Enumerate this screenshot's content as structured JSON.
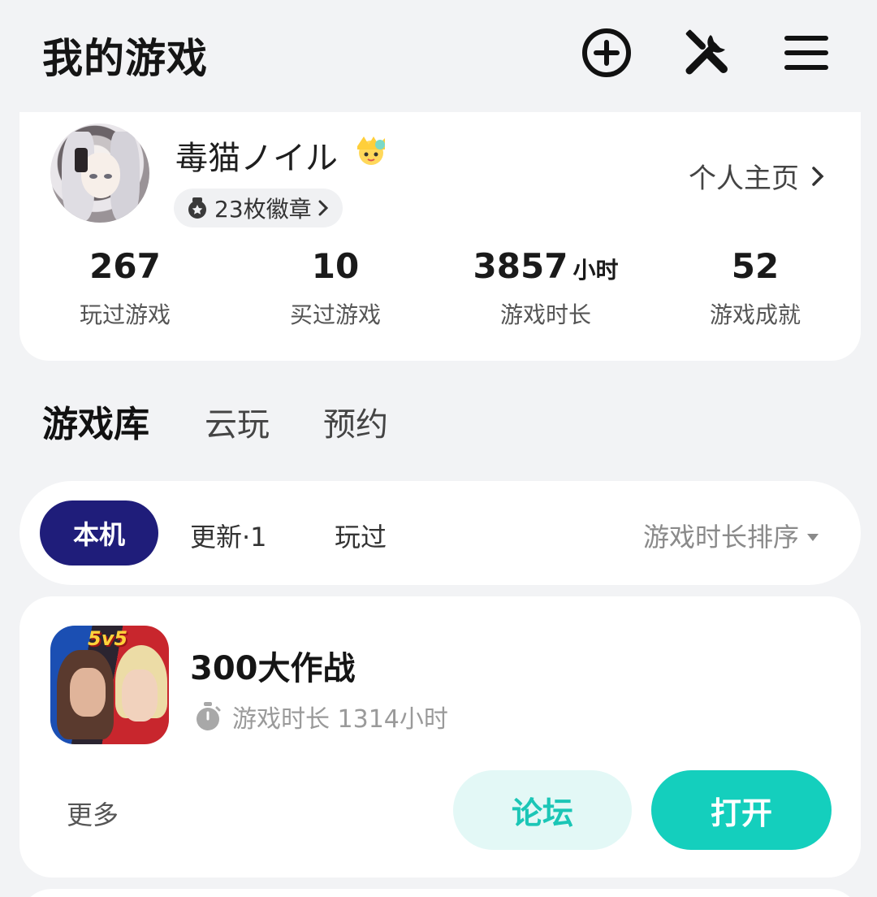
{
  "header": {
    "title": "我的游戏",
    "icons": [
      "add-circle-icon",
      "tools-icon",
      "menu-icon"
    ]
  },
  "profile": {
    "username": "毒猫ノイル",
    "badges_label": "23枚徽章",
    "homepage_label": "个人主页",
    "stats": [
      {
        "value": "267",
        "unit": "",
        "label": "玩过游戏"
      },
      {
        "value": "10",
        "unit": "",
        "label": "买过游戏"
      },
      {
        "value": "3857",
        "unit": "小时",
        "label": "游戏时长"
      },
      {
        "value": "52",
        "unit": "",
        "label": "游戏成就"
      }
    ]
  },
  "tabs": [
    {
      "label": "游戏库",
      "active": true
    },
    {
      "label": "云玩",
      "active": false
    },
    {
      "label": "预约",
      "active": false
    }
  ],
  "filters": {
    "chips": [
      {
        "label": "本机",
        "active": true
      },
      {
        "label": "更新·1",
        "active": false
      },
      {
        "label": "玩过",
        "active": false
      }
    ],
    "sort_label": "游戏时长排序"
  },
  "game": {
    "icon_tag": "5v5",
    "title": "300大作战",
    "playtime": "游戏时长 1314小时",
    "more_label": "更多",
    "forum_label": "论坛",
    "open_label": "打开"
  },
  "colors": {
    "accent": "#14cfbd",
    "chip_active": "#1f1d7a",
    "background": "#f2f3f5"
  }
}
